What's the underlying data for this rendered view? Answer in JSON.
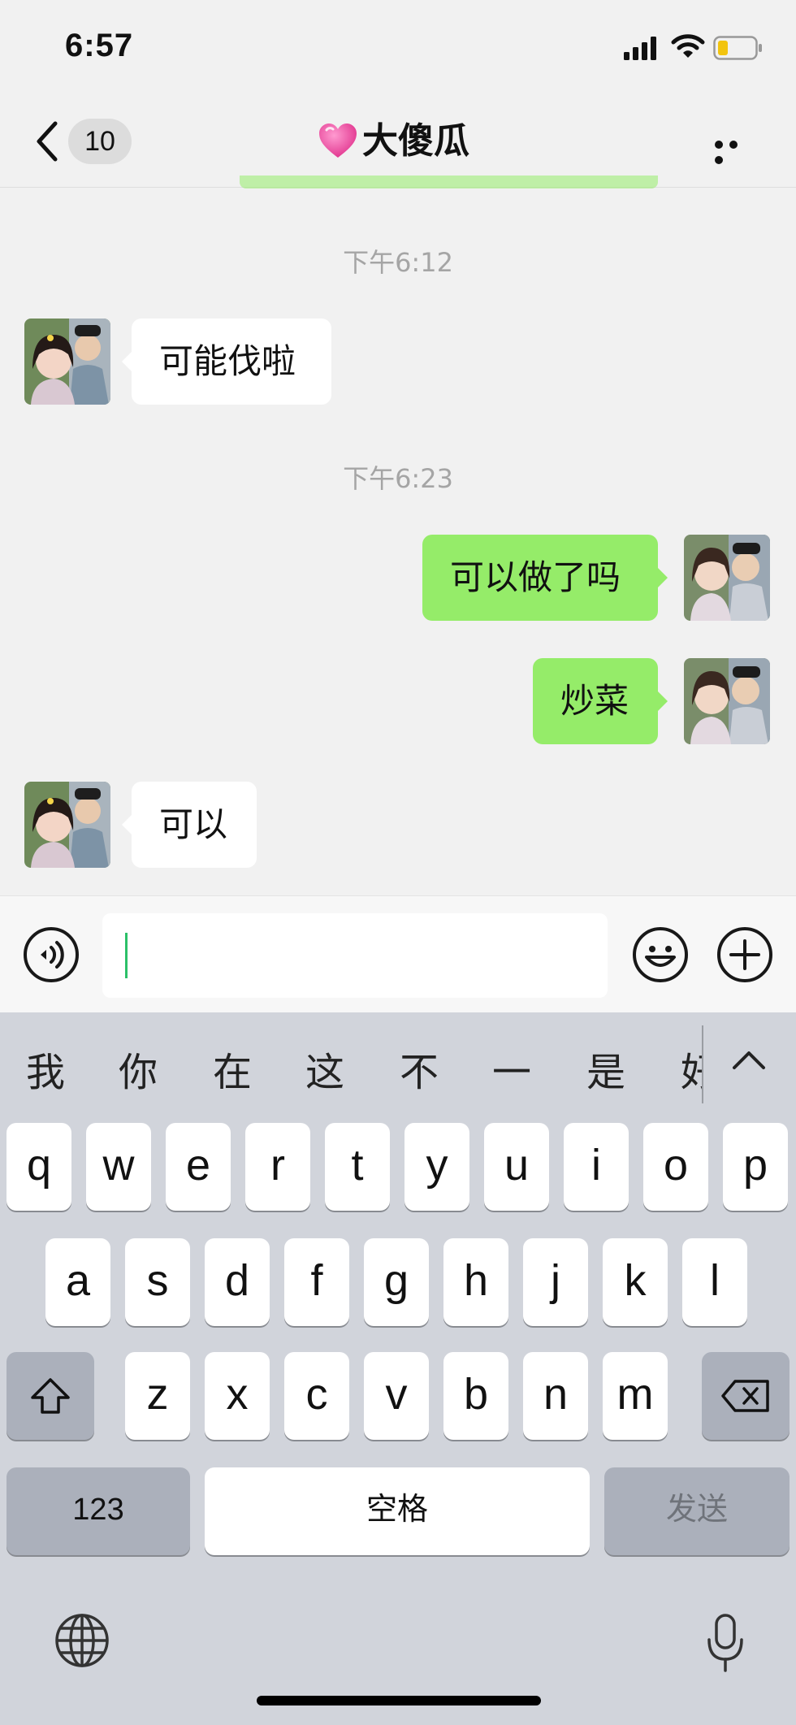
{
  "status": {
    "time": "6:57"
  },
  "nav": {
    "unread_count": "10",
    "title": "大傻瓜",
    "heart_emoji": "💗"
  },
  "messages": [
    {
      "type": "time",
      "text": "下午6:12"
    },
    {
      "type": "in",
      "text": "可能伐啦"
    },
    {
      "type": "time",
      "text": "下午6:23"
    },
    {
      "type": "out",
      "text": "可以做了吗"
    },
    {
      "type": "out",
      "text": "炒菜"
    },
    {
      "type": "in",
      "text": "可以"
    }
  ],
  "input": {
    "value": ""
  },
  "keyboard": {
    "candidates": [
      "我",
      "你",
      "在",
      "这",
      "不",
      "一",
      "是",
      "好"
    ],
    "row1": [
      "q",
      "w",
      "e",
      "r",
      "t",
      "y",
      "u",
      "i",
      "o",
      "p"
    ],
    "row2": [
      "a",
      "s",
      "d",
      "f",
      "g",
      "h",
      "j",
      "k",
      "l"
    ],
    "row3": [
      "z",
      "x",
      "c",
      "v",
      "b",
      "n",
      "m"
    ],
    "numbers_key": "123",
    "space_key": "空格",
    "send_key": "发送"
  },
  "colors": {
    "out_bubble": "#95ec69",
    "in_bubble": "#ffffff",
    "background": "#f1f1f1"
  }
}
